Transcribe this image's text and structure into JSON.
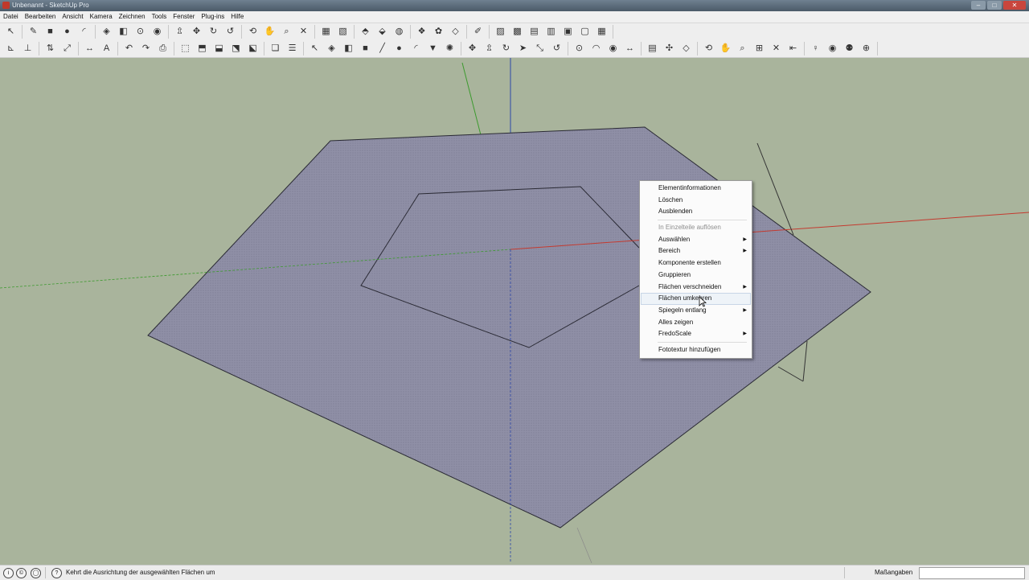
{
  "window": {
    "title": "Unbenannt - SketchUp Pro",
    "controls": {
      "minimize": "–",
      "maximize": "□",
      "close": "✕"
    }
  },
  "menubar": {
    "items": [
      "Datei",
      "Bearbeiten",
      "Ansicht",
      "Kamera",
      "Zeichnen",
      "Tools",
      "Fenster",
      "Plug-ins",
      "Hilfe"
    ]
  },
  "toolbar1": {
    "groups": [
      [
        {
          "icon": "select-arrow-icon",
          "glyph": "↖"
        }
      ],
      [
        {
          "icon": "pencil-icon",
          "glyph": "✎"
        },
        {
          "icon": "rectangle-icon",
          "glyph": "■"
        },
        {
          "icon": "circle-icon",
          "glyph": "●"
        },
        {
          "icon": "arc-icon",
          "glyph": "◜"
        }
      ],
      [
        {
          "icon": "make-component-icon",
          "glyph": "◈"
        },
        {
          "icon": "eraser-icon",
          "glyph": "◧"
        },
        {
          "icon": "tape-measure-icon",
          "glyph": "⊙"
        },
        {
          "icon": "paint-bucket-icon",
          "glyph": "◉"
        }
      ],
      [
        {
          "icon": "push-pull-icon",
          "glyph": "⇫"
        },
        {
          "icon": "move-icon",
          "glyph": "✥"
        },
        {
          "icon": "rotate-icon",
          "glyph": "↻"
        },
        {
          "icon": "offset-icon",
          "glyph": "↺"
        }
      ],
      [
        {
          "icon": "orbit-icon",
          "glyph": "⟲"
        },
        {
          "icon": "pan-icon",
          "glyph": "✋"
        },
        {
          "icon": "zoom-icon",
          "glyph": "⌕"
        },
        {
          "icon": "zoom-extents-icon",
          "glyph": "✕"
        }
      ],
      [
        {
          "icon": "get-models-icon",
          "glyph": "▦"
        },
        {
          "icon": "share-model-icon",
          "glyph": "▧"
        }
      ],
      [
        {
          "icon": "place-model-icon",
          "glyph": "⬘"
        },
        {
          "icon": "get-current-view-icon",
          "glyph": "⬙"
        },
        {
          "icon": "toggle-terrain-icon",
          "glyph": "◍"
        }
      ],
      [
        {
          "icon": "component-icon",
          "glyph": "❖"
        },
        {
          "icon": "share-component-icon",
          "glyph": "✿"
        },
        {
          "icon": "section-icon",
          "glyph": "◇"
        }
      ],
      [
        {
          "icon": "style-icon",
          "glyph": "✐"
        }
      ],
      [
        {
          "icon": "xray-icon",
          "glyph": "▨"
        },
        {
          "icon": "back-edges-icon",
          "glyph": "▩"
        },
        {
          "icon": "wireframe-icon",
          "glyph": "▤"
        },
        {
          "icon": "hidden-line-icon",
          "glyph": "▥"
        },
        {
          "icon": "shaded-icon",
          "glyph": "▣"
        },
        {
          "icon": "shaded-texture-icon",
          "glyph": "▢"
        },
        {
          "icon": "monochrome-icon",
          "glyph": "▦"
        }
      ]
    ]
  },
  "toolbar2": {
    "groups": [
      [
        {
          "icon": "axes-icon",
          "glyph": "⊾"
        },
        {
          "icon": "guide-icon",
          "glyph": "⊥"
        }
      ],
      [
        {
          "icon": "flip-icon",
          "glyph": "⇅"
        },
        {
          "icon": "scale-icon",
          "glyph": "⤢"
        }
      ],
      [
        {
          "icon": "dimension-icon",
          "glyph": "↔"
        },
        {
          "icon": "text-icon",
          "glyph": "A"
        }
      ],
      [
        {
          "icon": "undo-icon",
          "glyph": "↶"
        },
        {
          "icon": "redo-icon",
          "glyph": "↷"
        },
        {
          "icon": "print-icon",
          "glyph": "⎙"
        }
      ],
      [
        {
          "icon": "iso-view-icon",
          "glyph": "⬚"
        },
        {
          "icon": "top-view-icon",
          "glyph": "⬒"
        },
        {
          "icon": "front-view-icon",
          "glyph": "⬓"
        },
        {
          "icon": "right-view-icon",
          "glyph": "⬔"
        },
        {
          "icon": "back-view-icon",
          "glyph": "⬕"
        }
      ],
      [
        {
          "icon": "layers-icon",
          "glyph": "❏"
        },
        {
          "icon": "outliner-icon",
          "glyph": "☰"
        }
      ],
      [
        {
          "icon": "select-arrow-icon",
          "glyph": "↖"
        },
        {
          "icon": "component-small-icon",
          "glyph": "◈"
        },
        {
          "icon": "eraser-small-icon",
          "glyph": "◧"
        },
        {
          "icon": "rectangle-small-icon",
          "glyph": "■"
        },
        {
          "icon": "line-icon",
          "glyph": "╱"
        },
        {
          "icon": "circle-small-icon",
          "glyph": "●"
        },
        {
          "icon": "arc-small-icon",
          "glyph": "◜"
        },
        {
          "icon": "polygon-icon",
          "glyph": "▼"
        },
        {
          "icon": "freehand-icon",
          "glyph": "✺"
        }
      ],
      [
        {
          "icon": "move-small-icon",
          "glyph": "✥"
        },
        {
          "icon": "push-pull-small-icon",
          "glyph": "⇫"
        },
        {
          "icon": "rotate-small-icon",
          "glyph": "↻"
        },
        {
          "icon": "follow-me-icon",
          "glyph": "➤"
        },
        {
          "icon": "scale-small-icon",
          "glyph": "⤡"
        },
        {
          "icon": "offset-small-icon",
          "glyph": "↺"
        }
      ],
      [
        {
          "icon": "tape-icon",
          "glyph": "⊙"
        },
        {
          "icon": "protractor-icon",
          "glyph": "◠"
        },
        {
          "icon": "paint-small-icon",
          "glyph": "◉"
        },
        {
          "icon": "dimension-small-icon",
          "glyph": "↔"
        }
      ],
      [
        {
          "icon": "3d-text-icon",
          "glyph": "▤"
        },
        {
          "icon": "axes-small-icon",
          "glyph": "✣"
        },
        {
          "icon": "section-small-icon",
          "glyph": "◇"
        }
      ],
      [
        {
          "icon": "orbit-small-icon",
          "glyph": "⟲"
        },
        {
          "icon": "pan-small-icon",
          "glyph": "✋"
        },
        {
          "icon": "zoom-small-icon",
          "glyph": "⌕"
        },
        {
          "icon": "zoom-window-icon",
          "glyph": "⊞"
        },
        {
          "icon": "zoom-extents-small-icon",
          "glyph": "✕"
        },
        {
          "icon": "previous-view-icon",
          "glyph": "⇤"
        }
      ],
      [
        {
          "icon": "position-camera-icon",
          "glyph": "♀"
        },
        {
          "icon": "look-around-icon",
          "glyph": "◉"
        },
        {
          "icon": "walk-icon",
          "glyph": "⚉"
        },
        {
          "icon": "navigate-icon",
          "glyph": "⊕"
        }
      ]
    ]
  },
  "context_menu": {
    "items": [
      {
        "label": "Elementinformationen",
        "enabled": true,
        "submenu": false
      },
      {
        "label": "Löschen",
        "enabled": true,
        "submenu": false
      },
      {
        "label": "Ausblenden",
        "enabled": true,
        "submenu": false
      },
      {
        "separator": true
      },
      {
        "label": "In Einzelteile auflösen",
        "enabled": false,
        "submenu": false
      },
      {
        "label": "Auswählen",
        "enabled": true,
        "submenu": true
      },
      {
        "label": "Bereich",
        "enabled": true,
        "submenu": true
      },
      {
        "label": "Komponente erstellen",
        "enabled": true,
        "submenu": false
      },
      {
        "label": "Gruppieren",
        "enabled": true,
        "submenu": false
      },
      {
        "label": "Flächen verschneiden",
        "enabled": true,
        "submenu": true
      },
      {
        "label": "Flächen umkehren",
        "enabled": true,
        "submenu": false,
        "highlighted": true
      },
      {
        "label": "Spiegeln entlang",
        "enabled": true,
        "submenu": true
      },
      {
        "label": "Alles zeigen",
        "enabled": true,
        "submenu": false
      },
      {
        "label": "FredoScale",
        "enabled": true,
        "submenu": true
      },
      {
        "separator": true
      },
      {
        "label": "Fototextur hinzufügen",
        "enabled": true,
        "submenu": false
      }
    ],
    "submenu_arrow": "▶"
  },
  "statusbar": {
    "message": "Kehrt die Ausrichtung der ausgewählten Flächen um",
    "icons": [
      {
        "name": "geolocation-icon",
        "glyph": "i"
      },
      {
        "name": "credits-icon",
        "glyph": "©"
      },
      {
        "name": "user-icon",
        "glyph": "◯"
      },
      {
        "name": "help-icon",
        "glyph": "?"
      }
    ],
    "measurements_label": "Maßangaben",
    "measurements_value": ""
  },
  "colors": {
    "viewport_bg": "#a9b49c",
    "face_fill": "#8f8fa6",
    "axis_red": "#c43a2f",
    "axis_green": "#3c9a2e",
    "axis_blue": "#2c47a8"
  }
}
